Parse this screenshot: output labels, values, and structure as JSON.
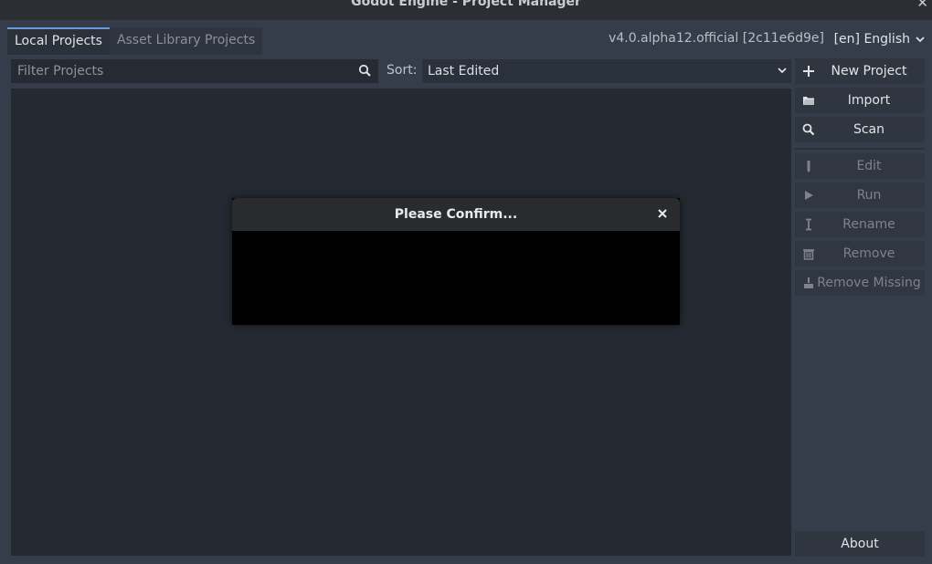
{
  "window": {
    "title": "Godot Engine - Project Manager",
    "close_glyph": "✕"
  },
  "tabs": [
    {
      "label": "Local Projects",
      "active": true
    },
    {
      "label": "Asset Library Projects",
      "active": false
    }
  ],
  "version": "v4.0.alpha12.official [2c11e6d9e]",
  "language": "[en] English",
  "filter": {
    "placeholder": "Filter Projects",
    "icon": "search-icon"
  },
  "sort": {
    "label": "Sort:",
    "value": "Last Edited"
  },
  "actions": {
    "new_project": "New Project",
    "import": "Import",
    "scan": "Scan",
    "edit": "Edit",
    "run": "Run",
    "rename": "Rename",
    "remove": "Remove",
    "remove_missing": "Remove Missing",
    "about": "About"
  },
  "dialog": {
    "title": "Please Confirm..."
  },
  "colors": {
    "accent": "#6b9bdb",
    "panel": "#252a32",
    "background": "#363d4a",
    "disabled_text": "#7d828b"
  }
}
